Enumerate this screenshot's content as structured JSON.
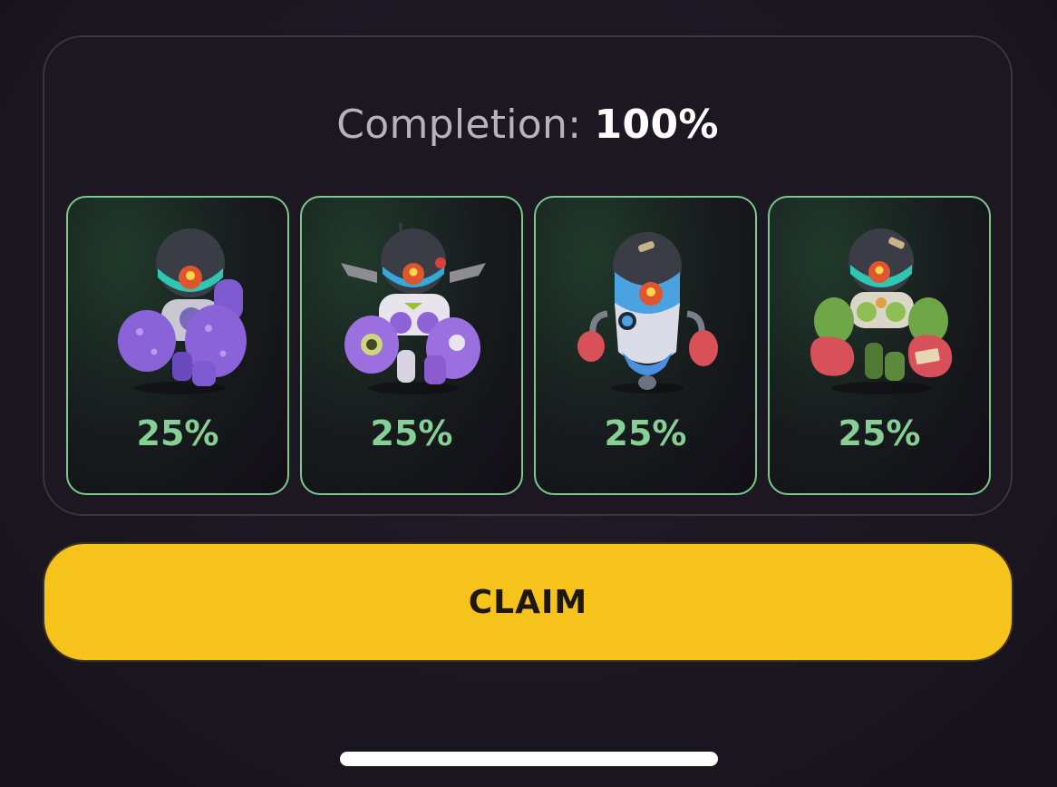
{
  "completion": {
    "label": "Completion:",
    "value": "100%"
  },
  "cards": [
    {
      "percent": "25%",
      "icon": "purple-robot-icon",
      "body_color": "#8a63d8",
      "accent_color": "#6a4bbf"
    },
    {
      "percent": "25%",
      "icon": "winged-robot-icon",
      "body_color": "#9b6fe0",
      "accent_color": "#e8e4ee"
    },
    {
      "percent": "25%",
      "icon": "boxer-robot-icon",
      "body_color": "#5b8fe0",
      "accent_color": "#d9dce6"
    },
    {
      "percent": "25%",
      "icon": "green-boxer-robot-icon",
      "body_color": "#6ea648",
      "accent_color": "#d8505a"
    }
  ],
  "claim_button": {
    "label": "CLAIM"
  },
  "colors": {
    "accent_green": "#79c98c",
    "claim_yellow": "#f6c21c",
    "background": "#1b1620"
  }
}
